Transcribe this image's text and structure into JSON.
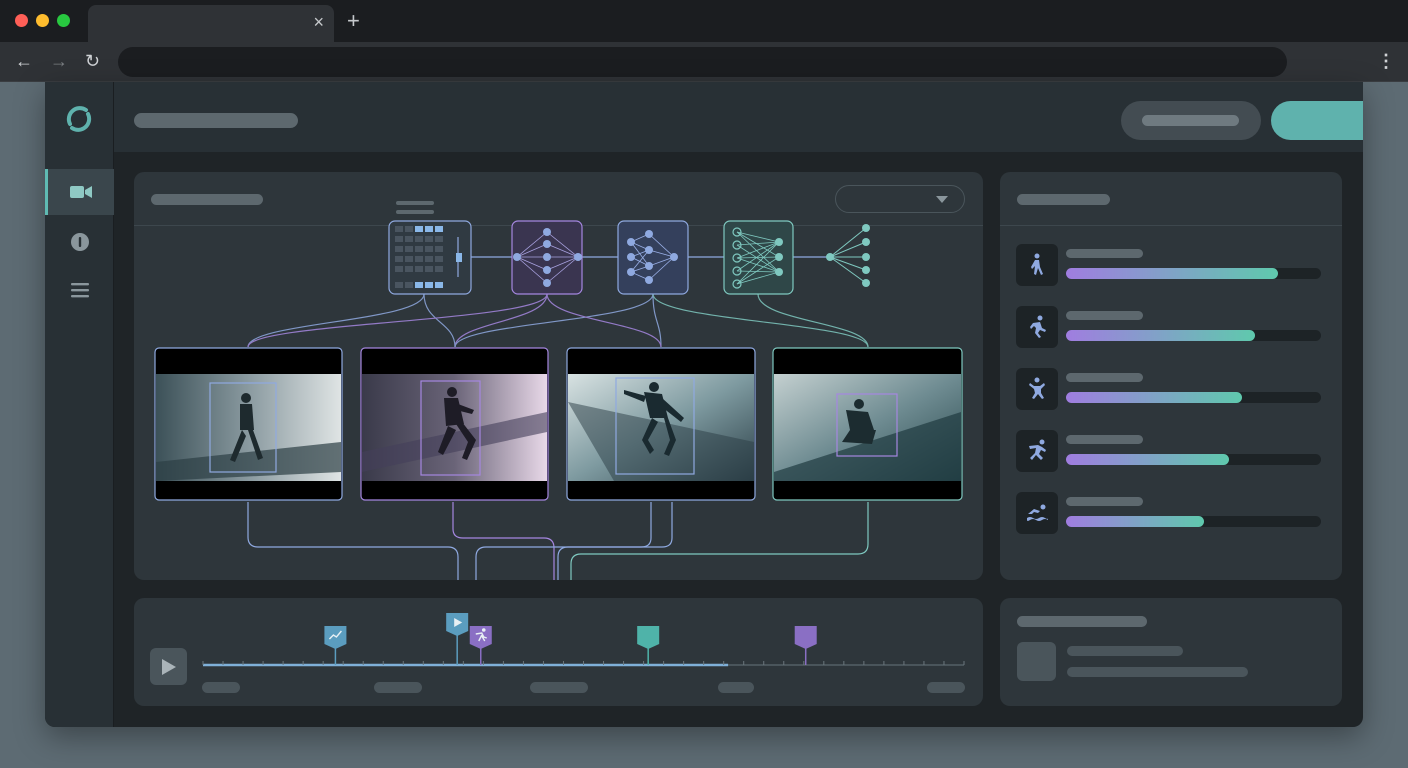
{
  "browser": {
    "tab_close_glyph": "×",
    "new_tab_glyph": "+",
    "back_glyph": "←",
    "forward_glyph": "→",
    "reload_glyph": "↻",
    "menu_glyph": "⋮"
  },
  "sidebar": {
    "items": [
      {
        "icon": "video-camera-icon",
        "active": true
      },
      {
        "icon": "info-icon",
        "active": false
      },
      {
        "icon": "menu-list-icon",
        "active": false
      }
    ]
  },
  "pipeline": {
    "nodes": [
      "feature-grid-icon",
      "neural-network-icon",
      "neural-network-icon",
      "dense-network-icon",
      "output-fanout-icon"
    ]
  },
  "frames": [
    {
      "pose": "walking"
    },
    {
      "pose": "running"
    },
    {
      "pose": "jumping"
    },
    {
      "pose": "crouching"
    }
  ],
  "activities": [
    {
      "icon": "walking-person-icon",
      "level": 0.83
    },
    {
      "icon": "running-person-icon",
      "level": 0.74
    },
    {
      "icon": "jumping-person-icon",
      "level": 0.69
    },
    {
      "icon": "sprinting-person-icon",
      "level": 0.64
    },
    {
      "icon": "swimming-person-icon",
      "level": 0.54
    }
  ],
  "timeline": {
    "progress": 0.69,
    "markers": [
      {
        "icon": "trend-icon",
        "color": "#5b9dbf",
        "at": 0.174
      },
      {
        "icon": "play-marker-icon",
        "color": "#5b9dbf",
        "at": 0.334
      },
      {
        "icon": "runner-icon",
        "color": "#8a6fc4",
        "at": 0.365
      },
      {
        "icon": "marker-icon",
        "color": "#4fb3a9",
        "at": 0.585
      },
      {
        "icon": "marker-icon",
        "color": "#8a6fc4",
        "at": 0.792
      }
    ]
  },
  "colors": {
    "accent": "#5fb2ad",
    "purple": "#a07de0",
    "teal": "#5fc9ad",
    "frame_border": "#8fa9e0"
  }
}
